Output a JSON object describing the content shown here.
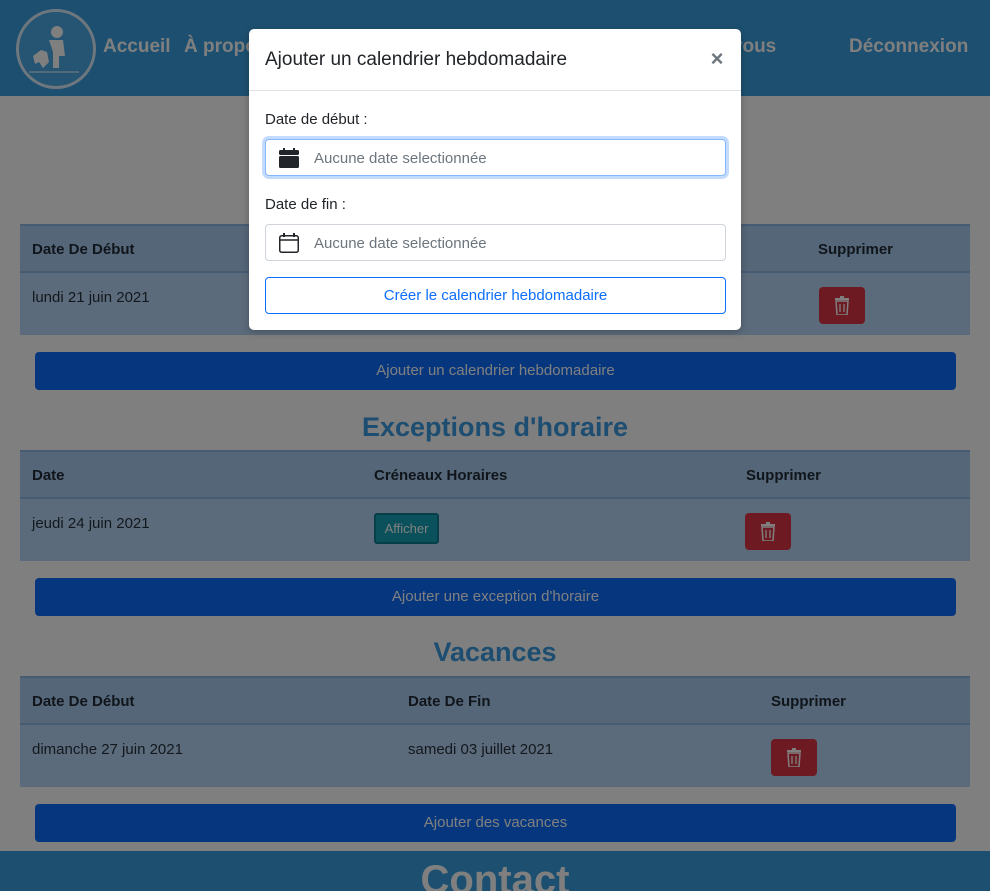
{
  "nav": {
    "links": [
      "Accueil",
      "À propos",
      "Rendez-vous",
      "Déconnexion"
    ]
  },
  "weekly": {
    "headers": [
      "Date De Début",
      "Supprimer"
    ],
    "rows": [
      {
        "start": "lundi 21 juin 2021"
      }
    ],
    "add_label": "Ajouter un calendrier hebdomadaire"
  },
  "exceptions": {
    "title": "Exceptions d'horaire",
    "headers": [
      "Date",
      "Créneaux Horaires",
      "Supprimer"
    ],
    "rows": [
      {
        "date": "jeudi 24 juin 2021",
        "show_label": "Afficher"
      }
    ],
    "add_label": "Ajouter une exception d'horaire"
  },
  "vacations": {
    "title": "Vacances",
    "headers": [
      "Date De Début",
      "Date De Fin",
      "Supprimer"
    ],
    "rows": [
      {
        "start": "dimanche 27 juin 2021",
        "end": "samedi 03 juillet 2021"
      }
    ],
    "add_label": "Ajouter des vacances"
  },
  "footer": {
    "title": "Contact"
  },
  "modal": {
    "title": "Ajouter un calendrier hebdomadaire",
    "close_symbol": "×",
    "start_label": "Date de début :",
    "start_placeholder": "Aucune date selectionnée",
    "end_label": "Date de fin :",
    "end_placeholder": "Aucune date selectionnée",
    "submit_label": "Créer le calendrier hebdomadaire"
  },
  "icons": {
    "trash": "trash-icon",
    "calendar_filled": "calendar-filled-icon",
    "calendar_outline": "calendar-outline-icon",
    "close": "close-icon"
  },
  "colors": {
    "nav_bg": "#3aa0e0",
    "primary": "#0d6efd",
    "danger": "#dc3545",
    "info": "#17a2b8",
    "section_title": "#3a9be0"
  }
}
